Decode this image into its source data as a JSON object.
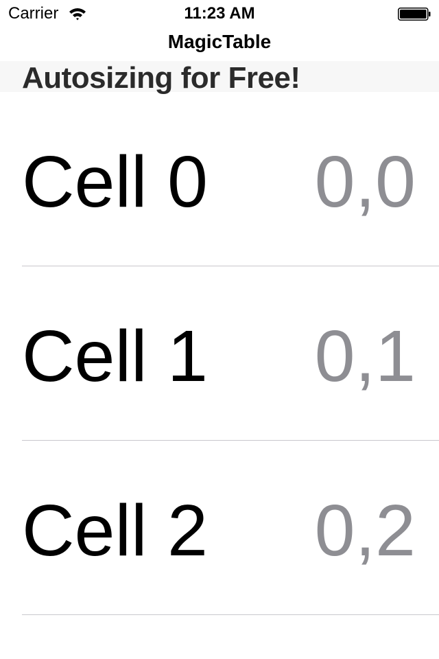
{
  "status_bar": {
    "carrier": "Carrier",
    "time": "11:23 AM",
    "wifi_icon": "wifi-icon",
    "battery_icon": "battery-icon"
  },
  "nav": {
    "title": "MagicTable"
  },
  "section": {
    "title": "Autosizing for Free!"
  },
  "rows": [
    {
      "label": "Cell 0",
      "detail": "0,0"
    },
    {
      "label": "Cell 1",
      "detail": "0,1"
    },
    {
      "label": "Cell 2",
      "detail": "0,2"
    }
  ],
  "colors": {
    "detail_text": "#8e8e93",
    "section_background": "#f7f7f7",
    "separator": "#c8c7cc"
  }
}
